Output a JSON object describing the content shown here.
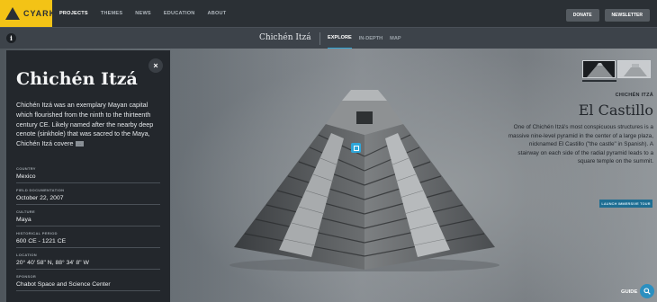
{
  "brand": {
    "name": "CYARK",
    "colors": {
      "yellow": "#f3c316",
      "dark": "#2b3035",
      "accent": "#2fa6d8"
    }
  },
  "nav": {
    "items": [
      {
        "label": "PROJECTS",
        "active": true
      },
      {
        "label": "THEMES",
        "active": false
      },
      {
        "label": "NEWS",
        "active": false
      },
      {
        "label": "EDUCATION",
        "active": false
      },
      {
        "label": "ABOUT",
        "active": false
      }
    ],
    "donate_label": "DONATE",
    "newsletter_label": "NEWSLETTER"
  },
  "subnav": {
    "info_icon": "i",
    "site_title": "Chichén Itzá",
    "tabs": [
      {
        "label": "EXPLORE",
        "active": true
      },
      {
        "label": "IN-DEPTH",
        "active": false
      },
      {
        "label": "MAP",
        "active": false
      }
    ]
  },
  "panel": {
    "title": "Chichén Itzá",
    "description": "Chichén Itzá was an exemplary Mayan capital which flourished from the ninth to the thirteenth century CE. Likely named after the nearby deep cenote (sinkhole) that was sacred to the Maya, Chichén Itzá covere",
    "more_icon": "...",
    "close_icon": "×",
    "fields": [
      {
        "label": "COUNTRY",
        "value": "Mexico"
      },
      {
        "label": "FIELD DOCUMENTATION",
        "value": "October 22, 2007"
      },
      {
        "label": "CULTURE",
        "value": "Maya"
      },
      {
        "label": "HISTORICAL PERIOD",
        "value": "600 CE - 1221 CE"
      },
      {
        "label": "LOCATION",
        "value": "20° 40' 58\" N, 88° 34' 8\" W"
      },
      {
        "label": "SPONSOR",
        "value": "Chabot Space and Science Center"
      }
    ]
  },
  "feature": {
    "eyebrow": "CHICHÉN ITZÁ",
    "title": "El Castillo",
    "description": "One of Chichén Itzá's most conspicuous structures is a massive nine-level pyramid in the center of a large plaza, nicknamed El Castillo (\"the castle\" in Spanish). A stairway on each side of the radial pyramid leads to a square temple on the summit.",
    "cta_label": "LAUNCH IMMERSIVE TOUR"
  },
  "guide": {
    "label": "GUIDE",
    "icon": "search-icon"
  }
}
